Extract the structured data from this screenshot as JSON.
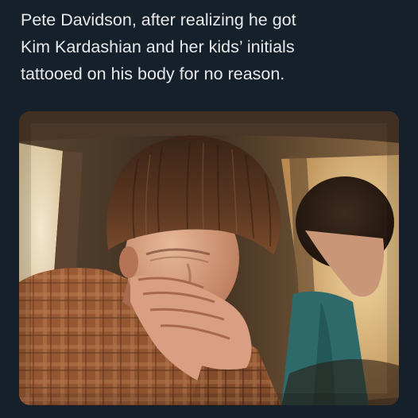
{
  "caption": {
    "lines": [
      "Pete Davidson, after realizing he got",
      "Kim Kardashian and her kids’ initials",
      "tattooed on his body for no reason."
    ]
  },
  "colors": {
    "background": "#15202b",
    "text": "#e7e9ea"
  }
}
